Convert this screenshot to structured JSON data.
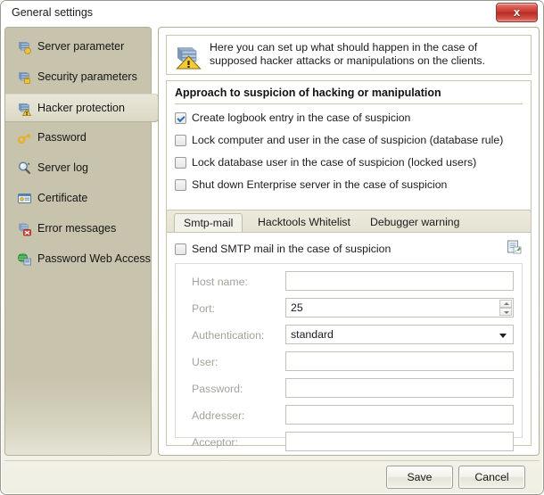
{
  "window": {
    "title": "General settings",
    "close_label": "x"
  },
  "sidebar": {
    "items": [
      {
        "label": "Server parameter",
        "icon": "server-icon",
        "selected": false
      },
      {
        "label": "Security parameters",
        "icon": "server-lock-icon",
        "selected": false
      },
      {
        "label": "Hacker protection",
        "icon": "server-warning-icon",
        "selected": true
      },
      {
        "label": "Password",
        "icon": "key-icon",
        "selected": false
      },
      {
        "label": "Server log",
        "icon": "magnifier-icon",
        "selected": false
      },
      {
        "label": "Certificate",
        "icon": "certificate-icon",
        "selected": false
      },
      {
        "label": "Error messages",
        "icon": "error-icon",
        "selected": false
      },
      {
        "label": "Password Web Access",
        "icon": "globe-icon",
        "selected": false
      }
    ]
  },
  "banner": {
    "icon": "server-warning-icon",
    "text": "Here you can set up what should happen in the case of supposed hacker attacks or manipulations on the clients."
  },
  "approach": {
    "title": "Approach to suspicion of hacking or manipulation",
    "options": [
      {
        "label": "Create logbook entry in the case of suspicion",
        "checked": true
      },
      {
        "label": "Lock computer and user in the case of suspicion (database rule)",
        "checked": false
      },
      {
        "label": "Lock database user in the case of suspicion (locked users)",
        "checked": false
      },
      {
        "label": "Shut down Enterprise server in the case of suspicion",
        "checked": false
      }
    ]
  },
  "tabs": [
    {
      "label": "Smtp-mail",
      "active": true
    },
    {
      "label": "Hacktools Whitelist",
      "active": false
    },
    {
      "label": "Debugger warning",
      "active": false
    }
  ],
  "smtp": {
    "enable_label": "Send SMTP mail in the case of suspicion",
    "enable_checked": false,
    "test_icon": "send-test-mail-icon",
    "fields": [
      {
        "name": "host-name",
        "label": "Host name:",
        "value": "",
        "type": "text",
        "placeholder": ""
      },
      {
        "name": "port",
        "label": "Port:",
        "value": "25",
        "type": "spin",
        "placeholder": ""
      },
      {
        "name": "authentication",
        "label": "Authentication:",
        "value": "standard",
        "type": "select",
        "placeholder": ""
      },
      {
        "name": "user",
        "label": "User:",
        "value": "",
        "type": "text",
        "placeholder": ""
      },
      {
        "name": "password",
        "label": "Password:",
        "value": "",
        "type": "text",
        "placeholder": ""
      },
      {
        "name": "addresser",
        "label": "Addresser:",
        "value": "",
        "type": "text",
        "placeholder": ""
      },
      {
        "name": "acceptor",
        "label": "Acceptor:",
        "value": "",
        "type": "text",
        "placeholder": ""
      }
    ]
  },
  "footer": {
    "save_label": "Save",
    "cancel_label": "Cancel"
  },
  "colors": {
    "sidebar_bg": "#c7c3ad",
    "panel_bg": "#ffffff",
    "border": "#b3af99",
    "close_red": "#c3372c",
    "check_blue": "#2b6fb5",
    "label_gray": "#a3a39b"
  }
}
